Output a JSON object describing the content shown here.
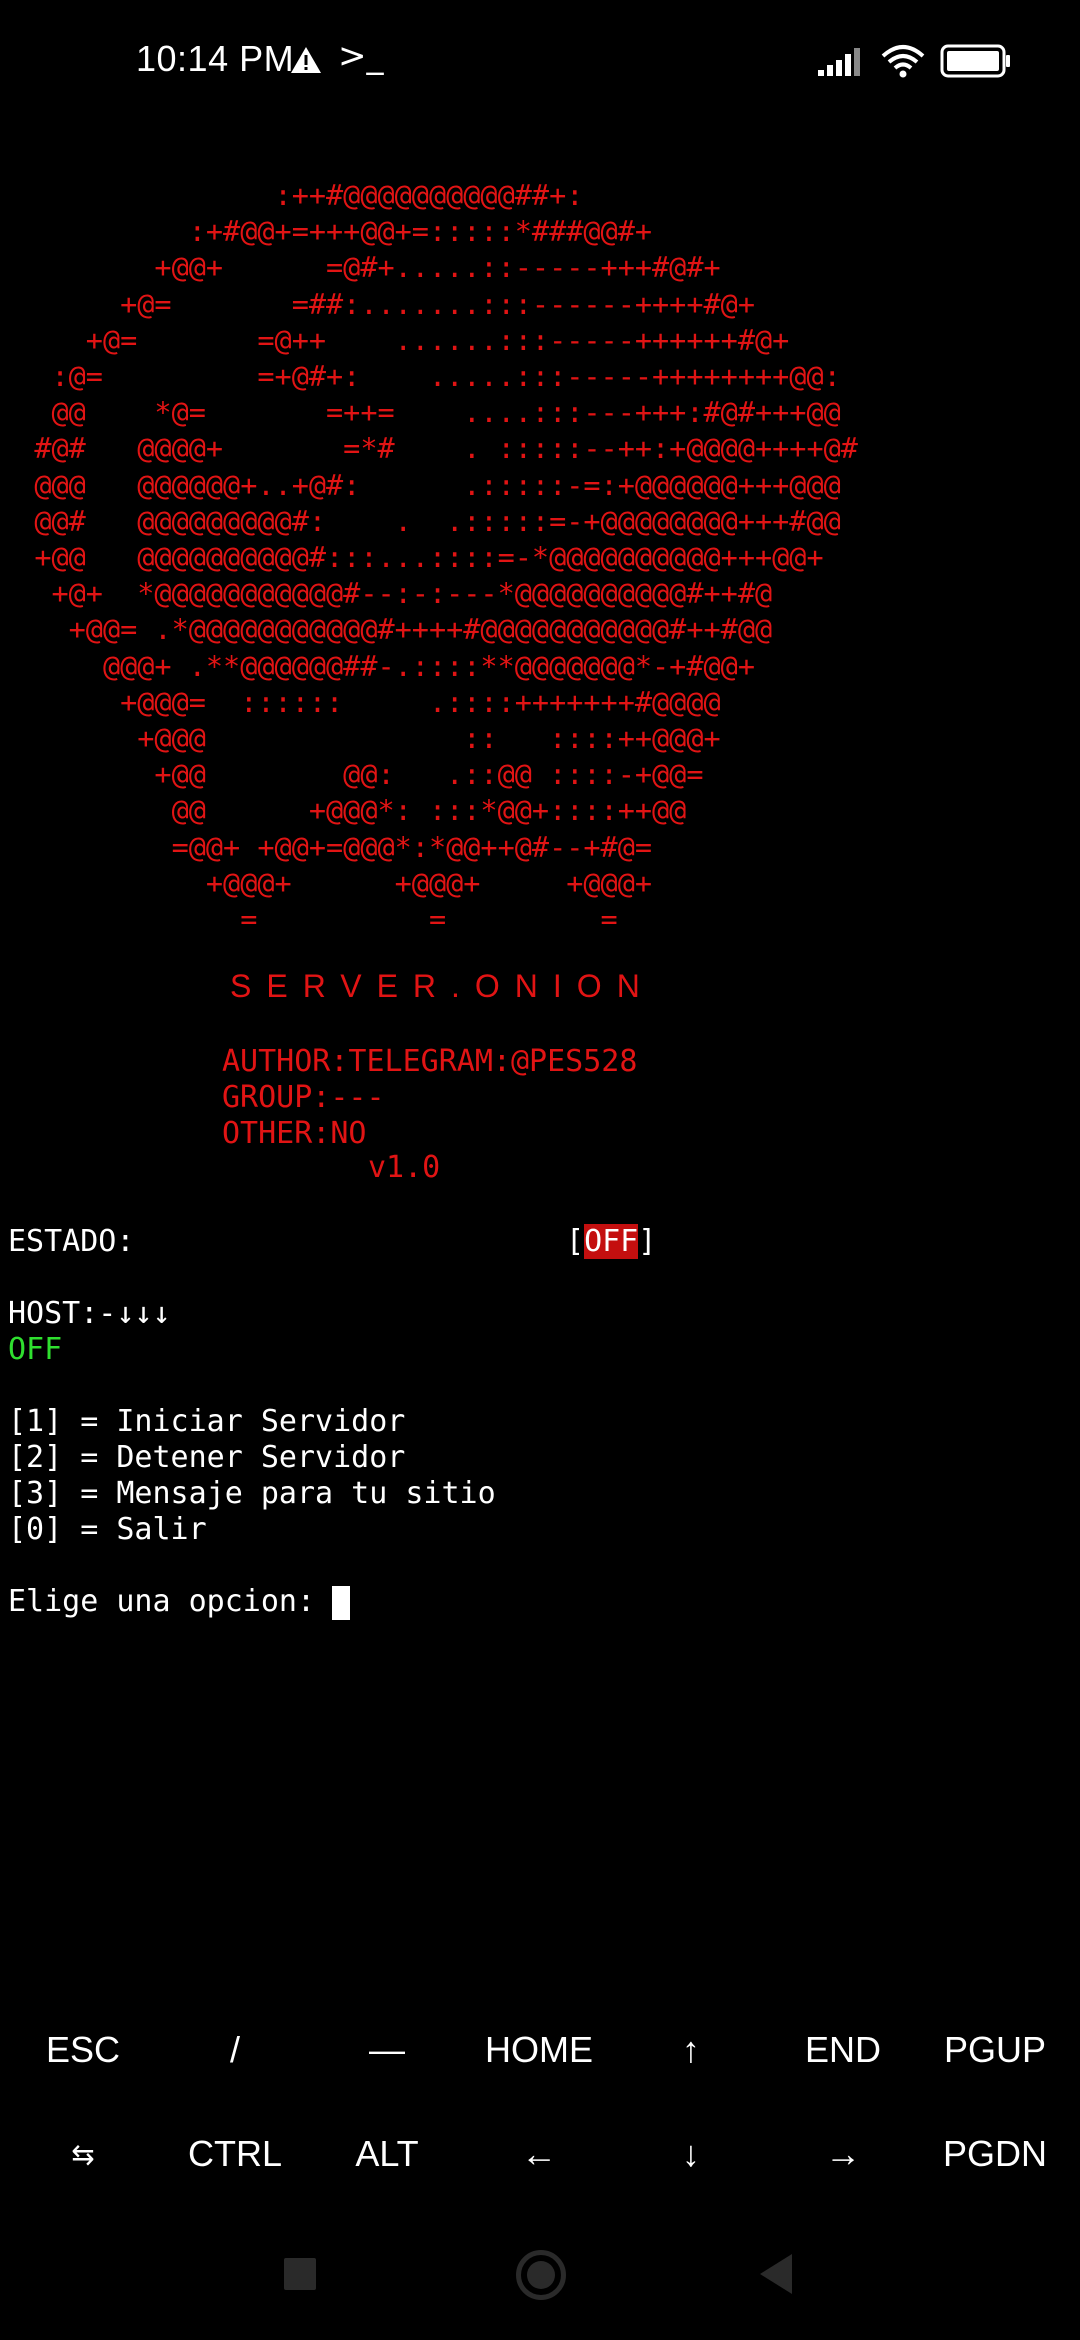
{
  "status_bar": {
    "time": "10:14 PM",
    "warning_icon": "warning-icon",
    "terminal_icon": ">_",
    "signal_icon": "signal-icon",
    "wifi_icon": "wifi-icon",
    "battery_icon": "battery-icon"
  },
  "ascii_art": "                :++#@@@@@@@@@@##+:\n           :+#@@+=+++@@+=:::::*###@@#+\n         +@@+      =@#+.....::-----+++#@#+\n       +@=       =##:.......:::------++++#@+\n     +@=       =@++    ......:::-----++++++#@+\n   :@=         =+@#+:    .....:::-----++++++++@@:\n   @@    *@=       =++=    ....:::---+++:#@#+++@@\n  #@#   @@@@+       =*#    . :::::--++:+@@@@++++@#\n  @@@   @@@@@@+..+@#:      .:::::-=:+@@@@@@+++@@@\n  @@#   @@@@@@@@@#:    .  .:::::=-+@@@@@@@@+++#@@\n  +@@   @@@@@@@@@@#:::...::::=-*@@@@@@@@@@+++@@+\n   +@+  *@@@@@@@@@@@#--:-:---*@@@@@@@@@@#++#@\n    +@@= .*@@@@@@@@@@@#++++#@@@@@@@@@@@#++#@@\n      @@@+ .**@@@@@@##-.::::**@@@@@@@*-+#@@+\n       +@@@=  ::::::     .::::+++++++#@@@@\n        +@@@               ::   ::::++@@@+\n         +@@        @@:   .::@@ ::::-+@@=\n          @@      +@@@*: :::*@@+::::++@@\n          =@@+ +@@+=@@@*:*@@++@#--+#@=\n            +@@@+      +@@@+     +@@@+\n              =          =         =",
  "banner": {
    "title": "SERVER.ONION",
    "author": "AUTHOR:TELEGRAM:@PES528",
    "group": "GROUP:---",
    "other": "OTHER:NO",
    "version": "v1.0"
  },
  "terminal": {
    "estado_label": "ESTADO:",
    "estado_open": "[",
    "estado_value": "OFF",
    "estado_close": "]",
    "host_label": "HOST:-↓↓↓",
    "host_value": "OFF",
    "menu": [
      "[1] = Iniciar Servidor",
      "[2] = Detener Servidor",
      "[3] = Mensaje para tu sitio",
      "[0] = Salir"
    ],
    "prompt": "Elige una opcion:"
  },
  "extra_keys": {
    "row1": [
      "ESC",
      "/",
      "—",
      "HOME",
      "↑",
      "END",
      "PGUP"
    ],
    "row2": [
      "⇆",
      "CTRL",
      "ALT",
      "←",
      "↓",
      "→",
      "PGDN"
    ]
  },
  "colors": {
    "background": "#000000",
    "accent_red": "#e11414",
    "status_green": "#2fe02f",
    "off_badge": "#c40f0f"
  }
}
